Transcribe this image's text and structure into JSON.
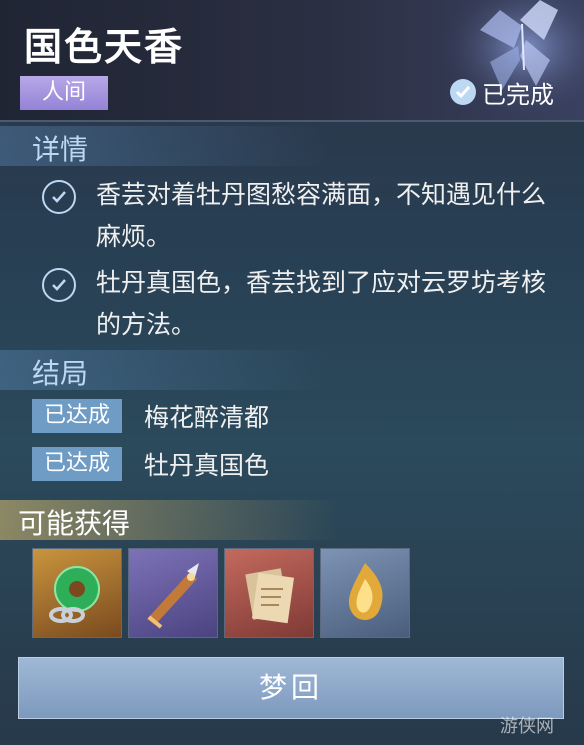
{
  "header": {
    "title": "国色天香",
    "realm": "人间",
    "status": "已完成"
  },
  "details": {
    "heading": "详情",
    "items": [
      {
        "text": "香芸对着牡丹图愁容满面，不知遇见什么麻烦。"
      },
      {
        "text": "牡丹真国色，香芸找到了应对云罗坊考核的方法。"
      }
    ]
  },
  "endings": {
    "heading": "结局",
    "items": [
      {
        "badge": "已达成",
        "name": "梅花醉清都"
      },
      {
        "badge": "已达成",
        "name": "牡丹真国色"
      }
    ]
  },
  "rewards": {
    "heading": "可能获得",
    "items": [
      {
        "icon": "jade-pendant-icon"
      },
      {
        "icon": "dagger-icon"
      },
      {
        "icon": "scroll-icon"
      },
      {
        "icon": "golden-flame-icon"
      }
    ]
  },
  "actions": {
    "dream_label": "梦回"
  },
  "watermark": "游侠网",
  "colors": {
    "realm_tag": "#a898e0",
    "badge": "#6f9cc4",
    "section_title": "#bcd7f2",
    "button": "#8fa9cb"
  }
}
